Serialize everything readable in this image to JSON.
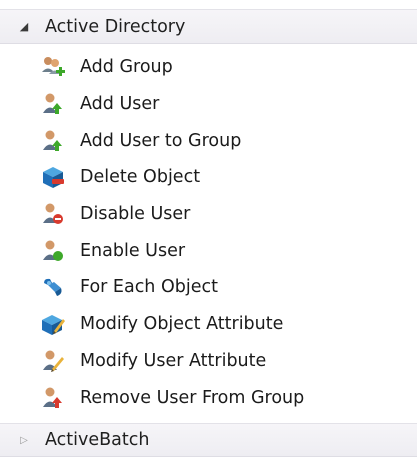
{
  "sections": [
    {
      "label": "Active Directory",
      "expanded": true,
      "items": [
        {
          "label": "Add Group",
          "icon": "add-group-icon"
        },
        {
          "label": "Add User",
          "icon": "add-user-icon"
        },
        {
          "label": "Add User to Group",
          "icon": "add-user-to-group-icon"
        },
        {
          "label": "Delete Object",
          "icon": "delete-object-icon"
        },
        {
          "label": "Disable User",
          "icon": "disable-user-icon"
        },
        {
          "label": "Enable User",
          "icon": "enable-user-icon"
        },
        {
          "label": "For Each Object",
          "icon": "for-each-object-icon"
        },
        {
          "label": "Modify Object Attribute",
          "icon": "modify-object-attribute-icon"
        },
        {
          "label": "Modify User Attribute",
          "icon": "modify-user-attribute-icon"
        },
        {
          "label": "Remove User From Group",
          "icon": "remove-user-from-group-icon"
        }
      ]
    },
    {
      "label": "ActiveBatch",
      "expanded": false,
      "items": []
    }
  ],
  "colors": {
    "header_bg": "#f1f0f4",
    "accent_green": "#3da82a",
    "accent_red": "#d83a2e",
    "accent_blue": "#1f6fb8"
  }
}
